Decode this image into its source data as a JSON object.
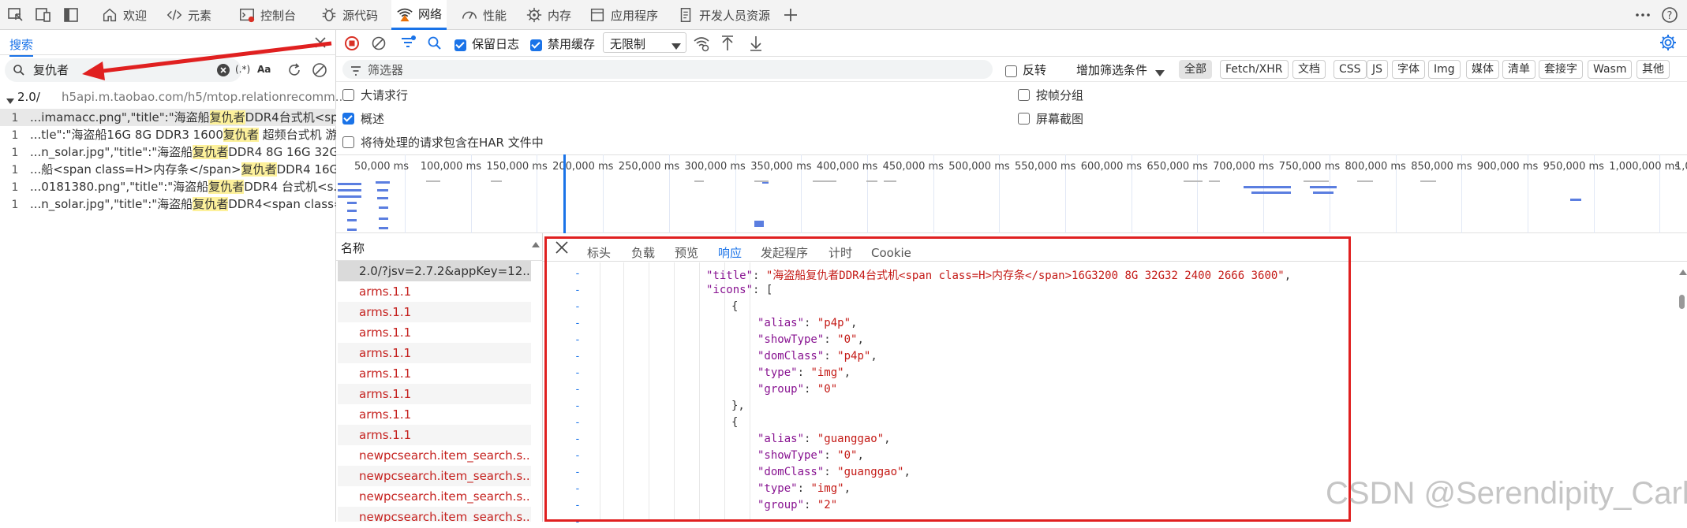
{
  "tabs": [
    {
      "label": "欢迎",
      "icon": "home-icon"
    },
    {
      "label": "元素",
      "icon": "code-icon"
    },
    {
      "label": "控制台",
      "icon": "console-icon"
    },
    {
      "label": "源代码",
      "icon": "bug-icon"
    },
    {
      "label": "网络",
      "icon": "wifi-icon"
    },
    {
      "label": "性能",
      "icon": "performance-icon"
    },
    {
      "label": "内存",
      "icon": "memory-icon"
    },
    {
      "label": "应用程序",
      "icon": "application-icon"
    },
    {
      "label": "开发人员资源",
      "icon": "developer-resources-icon"
    }
  ],
  "search": {
    "tab_label": "搜索",
    "query": "复仇者",
    "regex_label": "(.*)",
    "case_label": "Aa",
    "file_count": "2.0/",
    "file_url": "h5api.m.taobao.com/h5/mtop.relationrecomm...",
    "results": [
      {
        "num": "1",
        "pre": "...imamacc.png\",\"title\":\"海盗船",
        "match": "复仇者",
        "post": "DDR4台式机<sp..."
      },
      {
        "num": "1",
        "pre": "...tle\":\"海盗船16G 8G DDR3 1600",
        "match": "复仇者",
        "post": " 超频台式机 游..."
      },
      {
        "num": "1",
        "pre": "...n_solar.jpg\",\"title\":\"海盗船",
        "match": "复仇者",
        "post": "DDR4 8G 16G 32G..."
      },
      {
        "num": "1",
        "pre": "...船<span class=H>内存条</span>",
        "match": "复仇者",
        "post": "DDR4 16G..."
      },
      {
        "num": "1",
        "pre": "...0181380.png\",\"title\":\"海盗船",
        "match": "复仇者",
        "post": "DDR4 台式机<s..."
      },
      {
        "num": "1",
        "pre": "...n_solar.jpg\",\"title\":\"海盗船",
        "match": "复仇者",
        "post": "DDR4<span class=..."
      }
    ]
  },
  "toolbar": {
    "preserve_log": "保留日志",
    "disable_cache": "禁用缓存",
    "throttle": "无限制"
  },
  "filter": {
    "placeholder": "筛选器",
    "invert": "反转",
    "more_filters": "增加筛选条件",
    "types": [
      "全部",
      "Fetch/XHR",
      "文档",
      "CSS",
      "JS",
      "字体",
      "Img",
      "媒体",
      "清单",
      "套接字",
      "Wasm",
      "其他"
    ]
  },
  "options": {
    "large_rows": "大请求行",
    "overview": "概述",
    "har": "将待处理的请求包含在HAR 文件中",
    "group_frame": "按帧分组",
    "screenshots": "屏幕截图"
  },
  "timeline_ticks": [
    "50,000 ms",
    "100,000 ms",
    "150,000 ms",
    "200,000 ms",
    "250,000 ms",
    "300,000 ms",
    "350,000 ms",
    "400,000 ms",
    "450,000 ms",
    "500,000 ms",
    "550,000 ms",
    "600,000 ms",
    "650,000 ms",
    "700,000 ms",
    "750,000 ms",
    "800,000 ms",
    "850,000 ms",
    "900,000 ms",
    "950,000 ms",
    "1,000,000 ms",
    "1,05"
  ],
  "requests": {
    "header": "名称",
    "items": [
      "2.0/?jsv=2.7.2&appKey=12...",
      "arms.1.1",
      "arms.1.1",
      "arms.1.1",
      "arms.1.1",
      "arms.1.1",
      "arms.1.1",
      "arms.1.1",
      "arms.1.1",
      "newpcsearch.item_search.s...",
      "newpcsearch.item_search.s...",
      "newpcsearch.item_search.s...",
      "newpcsearch.item_search.s..."
    ]
  },
  "detail_tabs": [
    "标头",
    "负载",
    "预览",
    "响应",
    "发起程序",
    "计时",
    "Cookie"
  ],
  "response": {
    "title_key": "\"title\"",
    "title_value": "\"海盗船复仇者DDR4台式机<span class=H>内存条</span>16G3200 8G 32G32 2400 2666 3600\"",
    "icons_key": "\"icons\"",
    "obj1": [
      {
        "k": "\"alias\"",
        "v": "\"p4p\""
      },
      {
        "k": "\"showType\"",
        "v": "\"0\""
      },
      {
        "k": "\"domClass\"",
        "v": "\"p4p\""
      },
      {
        "k": "\"type\"",
        "v": "\"img\""
      },
      {
        "k": "\"group\"",
        "v": "\"0\""
      }
    ],
    "obj2": [
      {
        "k": "\"alias\"",
        "v": "\"guanggao\""
      },
      {
        "k": "\"showType\"",
        "v": "\"0\""
      },
      {
        "k": "\"domClass\"",
        "v": "\"guanggao\""
      },
      {
        "k": "\"type\"",
        "v": "\"img\""
      },
      {
        "k": "\"group\"",
        "v": "\"2\""
      }
    ]
  },
  "watermark": "CSDN @Serendipity_Carl",
  "colors": {
    "accent": "#1a73e8",
    "annotation": "#e02020",
    "record": "#d93025",
    "match_highlight": "#fdf19b"
  }
}
